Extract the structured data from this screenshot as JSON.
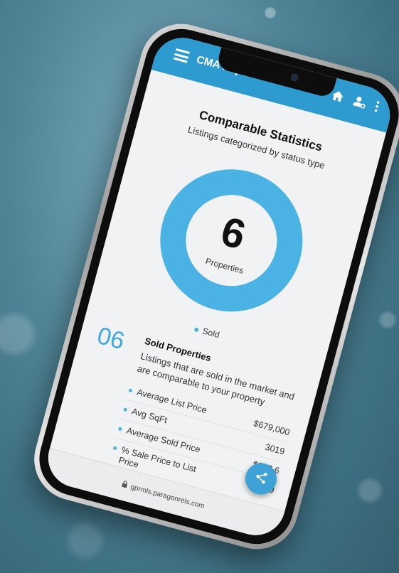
{
  "app_title": "CMA Repo",
  "stats": {
    "title": "Comparable Statistics",
    "subtitle": "Listings categorized by status type",
    "count": "6",
    "count_label": "Properties",
    "legend_sold": "Sold"
  },
  "sold": {
    "count_display": "06",
    "title": "Sold Properties",
    "description": "Listings that are sold in the market and are comparable to your property",
    "metrics": [
      {
        "label": "Average List Price",
        "value": "$679,000"
      },
      {
        "label": "Avg SqFt",
        "value": "3019"
      },
      {
        "label": "Average Sold Price",
        "value": "$670,6"
      },
      {
        "label": "% Sale Price to List Price",
        "value": "99"
      }
    ]
  },
  "url": "gprmls.paragonrels.com",
  "colors": {
    "accent": "#2e9bd0",
    "donut": "#4bb3e3",
    "count": "#3fa8dc"
  },
  "icons": [
    "menu-icon",
    "home-icon",
    "user-settings-icon",
    "more-vert-icon",
    "share-icon",
    "lock-icon"
  ]
}
